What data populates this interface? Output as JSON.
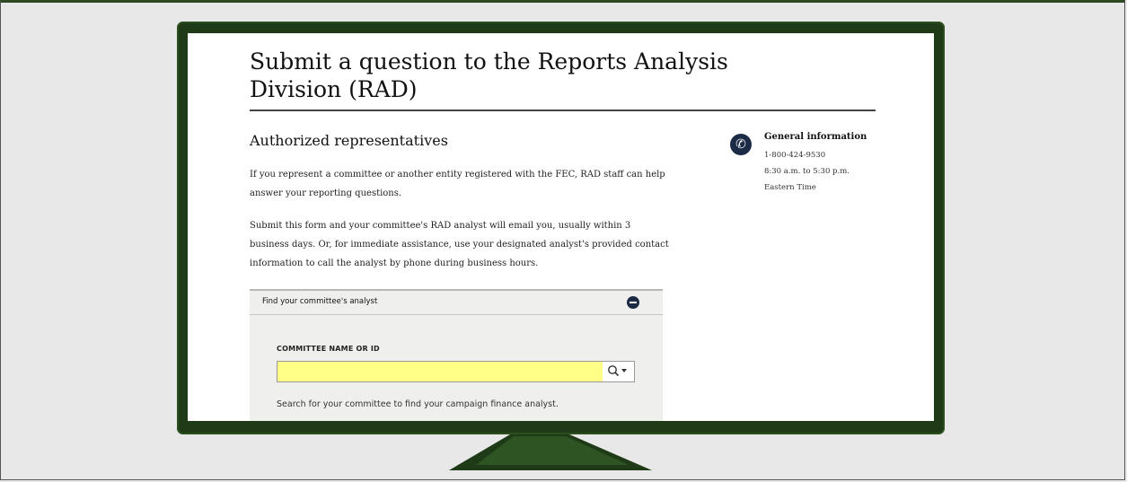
{
  "page": {
    "title": "Submit a question to the Reports Analysis Division (RAD)"
  },
  "section": {
    "heading": "Authorized representatives",
    "paragraph1": "If you represent a committee or another entity registered with the FEC, RAD staff can help answer your reporting questions.",
    "paragraph2": "Submit this form and your committee's RAD analyst will email you, usually within 3 business days. Or, for immediate assistance, use your designated analyst's provided contact information to call the analyst by phone during business hours."
  },
  "sidebar": {
    "icon": "phone-icon",
    "title": "General information",
    "phone": "1-800-424-9530",
    "hours": "8:30 a.m. to 5:30 p.m.",
    "timezone": "Eastern Time"
  },
  "panel": {
    "header": "Find your committee's analyst",
    "field_label": "COMMITTEE NAME OR ID",
    "search_value": "",
    "search_placeholder": "",
    "helper": "Search for your committee to find your campaign finance analyst."
  },
  "colors": {
    "monitor_frame": "#1f3a16",
    "accent_navy": "#1b2b45",
    "input_highlight": "#ffff88"
  }
}
